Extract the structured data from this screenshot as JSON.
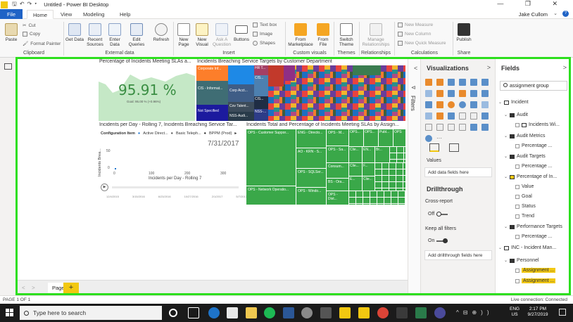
{
  "window": {
    "title": "Untitled - Power BI Desktop",
    "user": "Jake Cullom",
    "help": "?",
    "controls": "— ❐ ✕"
  },
  "menu_tabs": [
    "File",
    "Home",
    "View",
    "Modeling",
    "Help"
  ],
  "ribbon": {
    "clipboard": {
      "paste": "Paste",
      "cut": "Cut",
      "copy": "Copy",
      "format_painter": "Format Painter",
      "label": "Clipboard"
    },
    "external_data": {
      "get_data": "Get Data",
      "recent_sources": "Recent Sources",
      "enter_data": "Enter Data",
      "edit_queries": "Edit Queries",
      "refresh": "Refresh",
      "label": "External data"
    },
    "insert": {
      "new_page": "New Page",
      "new_visual": "New Visual",
      "ask_question": "Ask A Question",
      "buttons": "Buttons",
      "text_box": "Text box",
      "image": "Image",
      "shapes": "Shapes",
      "label": "Insert"
    },
    "custom_visuals": {
      "from_marketplace": "From Marketplace",
      "from_file": "From File",
      "label": "Custom visuals"
    },
    "themes": {
      "switch_theme": "Switch Theme",
      "label": "Themes"
    },
    "relationships": {
      "manage": "Manage Relationships",
      "label": "Relationships"
    },
    "calculations": {
      "new_measure": "New Measure",
      "new_column": "New Column",
      "new_quick_measure": "New Quick Measure",
      "label": "Calculations"
    },
    "share": {
      "publish": "Publish",
      "label": "Share"
    }
  },
  "canvas": {
    "kpi": {
      "title": "Percentage of Incidents Meeting SLAs a...",
      "value": "95.91 %",
      "goal": "Goal: 95.00 % (+0.96%)"
    },
    "treemap_dept": {
      "title": "Incidents Breaching Service Targets by Customer Department",
      "tiles": [
        "Corporate Inf...",
        "CIS - Informat...",
        "Corp Acct...",
        "Not Specified",
        "Cov Talent...",
        "NSS-Audi...",
        "HR T...",
        "CIS...",
        "CIS...",
        "NSS-..."
      ]
    },
    "line_chart": {
      "title": "Incidents per Day - Rolling 7, Incidents Breaching Service Tar...",
      "legend_label": "Configuration Item",
      "legend_items": [
        "Active Direct...",
        "Basic Teleph...",
        "BPPM (Prod)"
      ],
      "date": "7/31/2017",
      "ylabel": "Incidents Brea...",
      "xlabel": "Incidents per Day - Rolling 7",
      "y_ticks": [
        "50",
        "0"
      ],
      "x_ticks": [
        "0",
        "100",
        "200",
        "300"
      ],
      "slider_dates": [
        "12/4/2015",
        "3/15/2016",
        "6/23/2016",
        "10/27/2016",
        "2/1/2017",
        "5/7/2017"
      ],
      "play": "▶"
    },
    "treemap_total": {
      "title": "Incidents Total and Percentage of Incidents Meeting SLAs by Assign...",
      "tiles": [
        "OPS - Customer Suppor...",
        "ENG - Directo...",
        "OPS - M...",
        "OPS...",
        "OPS...",
        "Publ...",
        "OPS",
        "AO - KRN - S...",
        "OPS - Sa...",
        "Clie...",
        "EN...",
        "Br...",
        "Consum...",
        "Clie...",
        "F...",
        "OPS - SQLSer...",
        "BS - Ora...",
        "OPS - Network Operatio...",
        "OPS - Windo...",
        "OPS - Dist...",
        "E...",
        "Clie..."
      ]
    }
  },
  "page_tabs": {
    "nav_prev": "<",
    "nav_next": ">",
    "page1": "Page 1",
    "add": "+"
  },
  "filters_label": "Filters",
  "viz_pane": {
    "title": "Visualizations",
    "arrow_left": "<",
    "arrow_right": ">",
    "values_label": "Values",
    "add_data_fields": "Add data fields here",
    "drillthrough": "Drillthrough",
    "cross_report": "Cross-report",
    "cross_report_state": "Off",
    "keep_all_filters": "Keep all filters",
    "keep_all_filters_state": "On",
    "add_drillthrough": "Add drillthrough fields here"
  },
  "fields_pane": {
    "title": "Fields",
    "arrow_right": ">",
    "search_value": "assignment group",
    "tree": [
      {
        "label": "Incident",
        "level": 0
      },
      {
        "label": "Audit",
        "level": 1
      },
      {
        "label": "Incidents Wi...",
        "level": 2
      },
      {
        "label": "Audit Metrics",
        "level": 1
      },
      {
        "label": "Percentage ...",
        "level": 2
      },
      {
        "label": "Audit Targets",
        "level": 1
      },
      {
        "label": "Percentage ...",
        "level": 2
      },
      {
        "label": "Percentage of In...",
        "level": 1
      },
      {
        "label": "Value",
        "level": 2
      },
      {
        "label": "Goal",
        "level": 2
      },
      {
        "label": "Status",
        "level": 2
      },
      {
        "label": "Trend",
        "level": 2
      },
      {
        "label": "Performance Targets",
        "level": 1
      },
      {
        "label": "Percentage ...",
        "level": 2
      },
      {
        "label": "INC - Incident Man...",
        "level": 0
      },
      {
        "label": "Personnel",
        "level": 1
      },
      {
        "label": "Assignment ...",
        "level": 2
      },
      {
        "label": "Assignment ...",
        "level": 2
      }
    ]
  },
  "status": {
    "left": "PAGE 1 OF 1",
    "right": "Live connection: Connected"
  },
  "taskbar": {
    "search_placeholder": "Type here to search",
    "lang_top": "ENG",
    "lang_bottom": "US",
    "time": "2:17 PM",
    "date": "9/27/2019"
  }
}
